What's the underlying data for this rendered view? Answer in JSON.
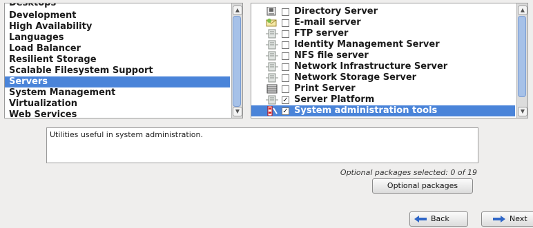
{
  "categories": {
    "items": [
      {
        "label": "Desktops",
        "selected": false
      },
      {
        "label": "Development",
        "selected": false
      },
      {
        "label": "High Availability",
        "selected": false
      },
      {
        "label": "Languages",
        "selected": false
      },
      {
        "label": "Load Balancer",
        "selected": false
      },
      {
        "label": "Resilient Storage",
        "selected": false
      },
      {
        "label": "Scalable Filesystem Support",
        "selected": false
      },
      {
        "label": "Servers",
        "selected": true
      },
      {
        "label": "System Management",
        "selected": false
      },
      {
        "label": "Virtualization",
        "selected": false
      },
      {
        "label": "Web Services",
        "selected": false
      }
    ]
  },
  "packages": {
    "items": [
      {
        "label": "Directory Server",
        "checked": false,
        "icon": "directory-server-icon",
        "selected": false
      },
      {
        "label": "E-mail server",
        "checked": false,
        "icon": "email-server-icon",
        "selected": false
      },
      {
        "label": "FTP server",
        "checked": false,
        "icon": "server-icon",
        "selected": false
      },
      {
        "label": "Identity Management Server",
        "checked": false,
        "icon": "server-icon",
        "selected": false
      },
      {
        "label": "NFS file server",
        "checked": false,
        "icon": "server-icon",
        "selected": false
      },
      {
        "label": "Network Infrastructure Server",
        "checked": false,
        "icon": "server-icon",
        "selected": false
      },
      {
        "label": "Network Storage Server",
        "checked": false,
        "icon": "server-icon",
        "selected": false
      },
      {
        "label": "Print Server",
        "checked": false,
        "icon": "printer-icon",
        "selected": false
      },
      {
        "label": "Server Platform",
        "checked": true,
        "icon": "server-icon",
        "selected": false
      },
      {
        "label": "System administration tools",
        "checked": true,
        "icon": "admin-tools-icon",
        "selected": true
      }
    ]
  },
  "description": "Utilities useful in system administration.",
  "optional_status": "Optional packages selected: 0 of 19",
  "buttons": {
    "optional_packages": "Optional packages",
    "back": "Back",
    "next": "Next"
  },
  "colors": {
    "selection": "#4a84d9",
    "background": "#efeeed"
  }
}
